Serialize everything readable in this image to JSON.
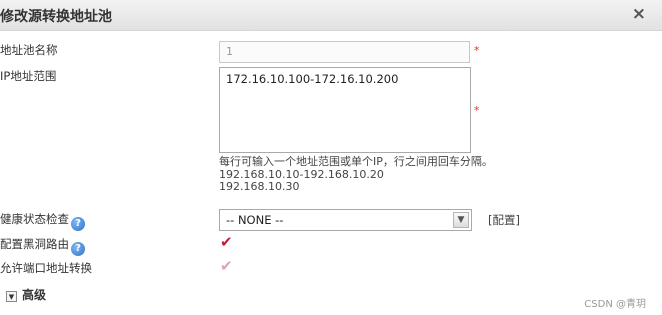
{
  "dialog": {
    "title": "修改源转换地址池",
    "close_glyph": "×"
  },
  "form": {
    "pool_name": {
      "label": "地址池名称",
      "value": "1",
      "required_mark": "*"
    },
    "ip_range": {
      "label": "IP地址范围",
      "value": "172.16.10.100-172.16.10.200",
      "required_mark": "*",
      "hint_lines": [
        "每行可输入一个地址范围或单个IP，行之间用回车分隔。",
        "192.168.10.10-192.168.10.20",
        "192.168.10.30"
      ]
    },
    "health_check": {
      "label": "健康状态检查",
      "help_glyph": "?",
      "selected": "-- NONE --",
      "arrow_glyph": "▼",
      "config_link": "[配置]"
    },
    "blackhole_route": {
      "label": "配置黑洞路由",
      "help_glyph": "?",
      "checked": true,
      "check_glyph": "✔"
    },
    "port_nat": {
      "label": "允许端口地址转换",
      "checked": true,
      "disabled": true,
      "check_glyph": "✔"
    }
  },
  "advanced": {
    "label": "高级",
    "toggle_glyph": "▼"
  },
  "watermark": "CSDN @青玥",
  "icons": {
    "help": "help-circle-icon",
    "close": "close-icon",
    "dropdown": "chevron-down-icon",
    "check": "checkmark-icon",
    "expand": "expand-toggle-icon"
  },
  "colors": {
    "required": "#e0352b",
    "check_active": "#c21f35",
    "check_disabled": "#e0a3ad",
    "help_icon": "#2d74c8"
  }
}
